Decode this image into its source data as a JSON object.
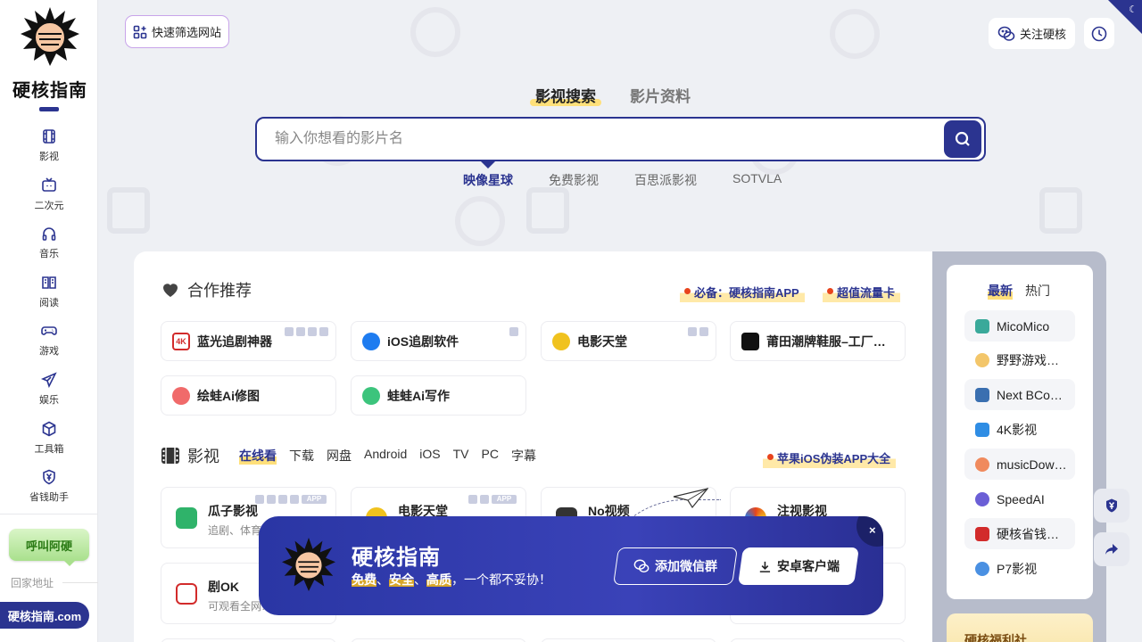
{
  "sidebar": {
    "logo_text": "硬核指南",
    "nav": [
      {
        "label": "影视",
        "icon": "film-icon"
      },
      {
        "label": "二次元",
        "icon": "anime-tv-icon"
      },
      {
        "label": "音乐",
        "icon": "headphones-icon"
      },
      {
        "label": "阅读",
        "icon": "book-icon"
      },
      {
        "label": "游戏",
        "icon": "gamepad-icon"
      },
      {
        "label": "娱乐",
        "icon": "paper-plane-icon"
      },
      {
        "label": "工具箱",
        "icon": "cube-icon"
      },
      {
        "label": "省钱助手",
        "icon": "shield-yen-icon"
      }
    ],
    "call_button": "呼叫阿硬",
    "home_address": "回家地址",
    "domain": "硬核指南.com"
  },
  "topbar": {
    "filter_button": "快速筛选网站",
    "follow_button": "关注硬核"
  },
  "search": {
    "tabs": [
      "影视搜索",
      "影片资料"
    ],
    "active_tab": "影视搜索",
    "placeholder": "输入你想看的影片名",
    "engines": [
      "映像星球",
      "免费影视",
      "百思派影视",
      "SOTVLA"
    ],
    "active_engine": "映像星球"
  },
  "partners": {
    "title": "合作推荐",
    "promo_app": "必备：硬核指南APP",
    "promo_card": "超值流量卡",
    "items": [
      {
        "name": "蓝光追剧神器",
        "color": "#d22b2b",
        "badge": "4K"
      },
      {
        "name": "iOS追剧软件",
        "color": "#1e7cf0",
        "badge": ""
      },
      {
        "name": "电影天堂",
        "color": "#f0c21e",
        "badge": ""
      },
      {
        "name": "莆田潮牌鞋服–工厂…",
        "color": "#111111",
        "badge": ""
      },
      {
        "name": "绘蛙Ai修图",
        "color": "#f06a6a",
        "badge": ""
      },
      {
        "name": "蛙蛙Ai写作",
        "color": "#3cc47c",
        "badge": ""
      }
    ]
  },
  "movies": {
    "title": "影视",
    "tabs": [
      "在线看",
      "下载",
      "网盘",
      "Android",
      "iOS",
      "TV",
      "PC",
      "字幕"
    ],
    "active_tab": "在线看",
    "promo": "苹果iOS伪装APP大全",
    "items": [
      {
        "name": "瓜子影视",
        "desc": "追剧、体育…",
        "color": "#2fb36a"
      },
      {
        "name": "电影天堂",
        "desc": "",
        "color": "#f0c21e"
      },
      {
        "name": "No视频",
        "desc": "",
        "color": "#333333"
      },
      {
        "name": "注视影视",
        "desc": "…",
        "color": "#e8441c"
      },
      {
        "name": "剧OK",
        "desc": "可观看全网…",
        "color": "#d22b2b"
      }
    ]
  },
  "right_panel": {
    "tabs": [
      "最新",
      "热门"
    ],
    "active_tab": "最新",
    "items": [
      {
        "label": "MicoMico",
        "color": "#3aa99a"
      },
      {
        "label": "野野游戏…",
        "color": "#f3c66a"
      },
      {
        "label": "Next BCo…",
        "color": "#3a6fb0"
      },
      {
        "label": "4K影视",
        "color": "#2f8de4"
      },
      {
        "label": "musicDow…",
        "color": "#f08a5d"
      },
      {
        "label": "SpeedAI",
        "color": "#6b5fd6"
      },
      {
        "label": "硬核省钱…",
        "color": "#d22b2b"
      },
      {
        "label": "P7影视",
        "color": "#4a90e2"
      }
    ],
    "welfare_title": "硬核福利社"
  },
  "banner": {
    "title": "硬核指南",
    "highlights": [
      "免费",
      "安全",
      "高质"
    ],
    "separator": "、",
    "tail": "，一个都不妥协！",
    "wechat_button": "添加微信群",
    "android_button": "安卓客户端",
    "close": "×"
  },
  "colors": {
    "brand": "#2b3490",
    "highlight": "#ffe07a",
    "background": "#eef0f4"
  }
}
